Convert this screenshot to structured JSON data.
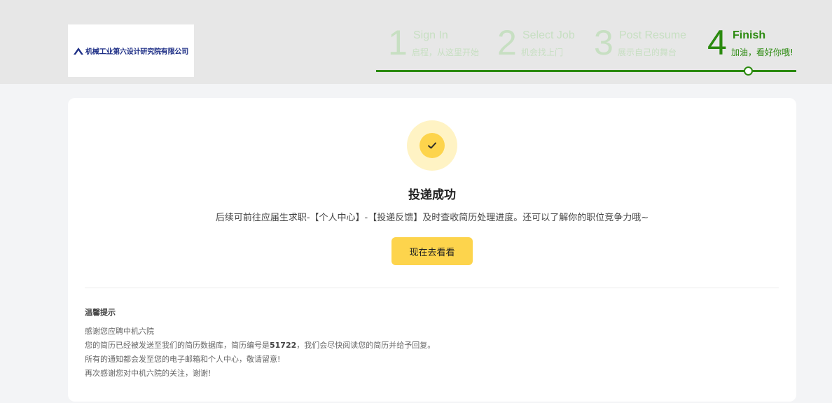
{
  "header": {
    "logo_text": "机械工业第六设计研究院有限公司",
    "steps": [
      {
        "number": "1",
        "title": "Sign In",
        "subtitle": "启程，从这里开始"
      },
      {
        "number": "2",
        "title": "Select Job",
        "subtitle": "机会找上门"
      },
      {
        "number": "3",
        "title": "Post Resume",
        "subtitle": "展示自己的舞台"
      },
      {
        "number": "4",
        "title": "Finish",
        "subtitle": "加油，看好你哦!"
      }
    ],
    "active_step": 4
  },
  "result": {
    "icon": "check-icon",
    "title": "投递成功",
    "description": "后续可前往应届生求职-【个人中心】-【投递反馈】及时查收简历处理进度。还可以了解你的职位竞争力哦~",
    "button_label": "现在去看看"
  },
  "tips": {
    "title": "温馨提示",
    "line1": "感谢您应聘中机六院",
    "line2_prefix": "您的简历已经被发送至我们的简历数据库，简历编号是",
    "resume_number": "51722",
    "line2_suffix": "，我们会尽快阅读您的简历并给予回复。",
    "line3": "所有的通知都会发至您的电子邮箱和个人中心，敬请留意!",
    "line4": "再次感谢您对中机六院的关注，谢谢!"
  },
  "colors": {
    "accent_green": "#2b8a0f",
    "inactive_green": "#c7dfc2",
    "button_yellow": "#fdd44c",
    "icon_bg": "#fff3c4"
  }
}
